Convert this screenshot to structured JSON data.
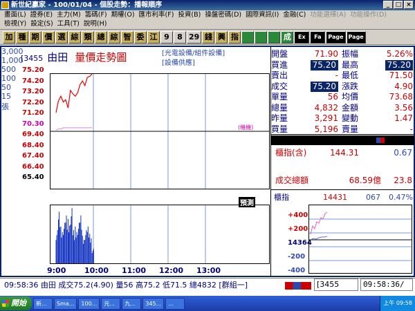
{
  "window": {
    "title": "新世紀贏家 - 100/01/04 - 個股走勢：播報順序"
  },
  "menu_row1": [
    "畫面(L)",
    "證券(E)",
    "主力(M)",
    "籌碼(F)",
    "期權(O)",
    "匯市利率(F)",
    "投資(B)",
    "操盤密碼(D)",
    "國際資訊(I)",
    "金融(C)",
    "功能選擇(A)",
    "功能操作(D)"
  ],
  "menu_row2": [
    "檢視(Y)",
    "設定(S)",
    "工具(T)",
    "說明(H)"
  ],
  "toolbar": [
    "加",
    "種",
    "期",
    "價",
    "選",
    "綜",
    "類",
    "總",
    "綜",
    "智",
    "委",
    "江",
    "9",
    "8",
    "29",
    "錢",
    "興",
    "指",
    "",
    "",
    "",
    "成",
    "Ex",
    "Fa",
    "Page",
    "Page"
  ],
  "stock": {
    "code": "[3455",
    "name": "由田",
    "title": "量價走勢圖",
    "industry_line1": "[光電設備/組件設備]",
    "industry_line2": "[設備供應]"
  },
  "price_axis": [
    "75.20",
    "74.20",
    "73.20",
    "72.20",
    "71.20",
    "70.30",
    "69.40",
    "68.40",
    "67.40",
    "66.40",
    "65.40"
  ],
  "volume_axis": [
    "3,000",
    "1,000",
    "500",
    "100",
    "50",
    "15",
    "張"
  ],
  "time_axis": [
    "9:00",
    "10:00",
    "11:00",
    "12:00",
    "13:00"
  ],
  "avg_tag": "(機機)",
  "hint_tag": "預測",
  "quote": [
    {
      "l1": "開盤",
      "v1": "71.90",
      "l2": "振幅",
      "v2": "5.26%"
    },
    {
      "l1": "買進",
      "v1": "75.20",
      "l2": "最高",
      "v2": "75.20"
    },
    {
      "l1": "賣出",
      "v1": "-",
      "l2": "最低",
      "v2": "71.50"
    },
    {
      "l1": "成交",
      "v1": "75.20",
      "l2": "漲跌",
      "v2": "4.90"
    },
    {
      "l1": "單量",
      "v1": "56",
      "l2": "均價",
      "v2": "73.68"
    },
    {
      "l1": "總量",
      "v1": "4,832",
      "l2": "金額",
      "v2": "3.56"
    },
    {
      "l1": "昨量",
      "v1": "3,291",
      "l2": "變動",
      "v2": "1.47"
    },
    {
      "l1": "買量",
      "v1": "5,196",
      "l2": "賣量",
      "v2": "-"
    }
  ],
  "index_row": {
    "label": "櫃指(含)",
    "value": "144.31",
    "change": "0.67"
  },
  "total_row": {
    "label": "成交總額",
    "value": "68.59億",
    "change": "23.8"
  },
  "mini": {
    "label": "櫃指",
    "value": "14431",
    "change": "067",
    "pct": "0.47%",
    "axis": [
      "+400",
      "+200",
      "14364",
      "-200",
      "-400"
    ]
  },
  "status": {
    "text": "09:58:36 由田 成交75.2(4.90) 量56 高75.2 低71.5 總4832 [群組一]",
    "code": "[3455",
    "time": "09:58:36/"
  },
  "taskbar": {
    "start": "開始",
    "tasks": [
      "新...",
      "Sma...",
      "100...",
      "元...",
      "九...",
      "345...",
      "..."
    ],
    "clock": "上午 09:58"
  },
  "chart_data": {
    "type": "line",
    "title": "量價走勢圖",
    "x": [
      "9:00",
      "9:04",
      "9:08",
      "9:12",
      "9:16",
      "9:20",
      "9:24",
      "9:28",
      "9:32",
      "9:36",
      "9:40",
      "9:44",
      "9:48",
      "9:52",
      "9:56",
      "9:58"
    ],
    "series": [
      {
        "values": [
          71.9,
          72.9,
          73.3,
          72.8,
          73.0,
          72.3,
          73.8,
          73.5,
          73.3,
          73.6,
          74.3,
          74.6,
          74.2,
          74.9,
          75.0,
          75.2
        ]
      }
    ],
    "avg": [
      70.4,
      70.5,
      70.5,
      70.6,
      70.6,
      70.6,
      70.6,
      70.6,
      70.6,
      70.6,
      70.6,
      70.6,
      70.6,
      70.6,
      70.6,
      70.6
    ],
    "ylim": [
      65.4,
      75.2
    ],
    "volume": [
      1800,
      2800,
      2000,
      2200,
      2600,
      2400,
      3000,
      1800,
      2000,
      2200,
      2600,
      1500,
      1800,
      2000,
      1600,
      800
    ],
    "volume_ylim": [
      0,
      3000
    ]
  }
}
